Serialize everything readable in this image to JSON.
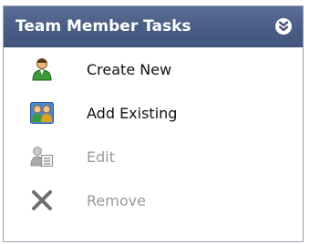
{
  "panel": {
    "title": "Team Member Tasks",
    "collapse_icon": "double-chevron-down-icon"
  },
  "tasks": [
    {
      "label": "Create New",
      "icon": "user-add-icon",
      "enabled": true
    },
    {
      "label": "Add Existing",
      "icon": "users-group-icon",
      "enabled": true
    },
    {
      "label": "Edit",
      "icon": "user-edit-icon",
      "enabled": false
    },
    {
      "label": "Remove",
      "icon": "x-remove-icon",
      "enabled": false
    }
  ],
  "colors": {
    "header_bg": "#4a5e86",
    "header_text": "#ffffff",
    "enabled_text": "#111111",
    "disabled_text": "#9a9a9a"
  }
}
